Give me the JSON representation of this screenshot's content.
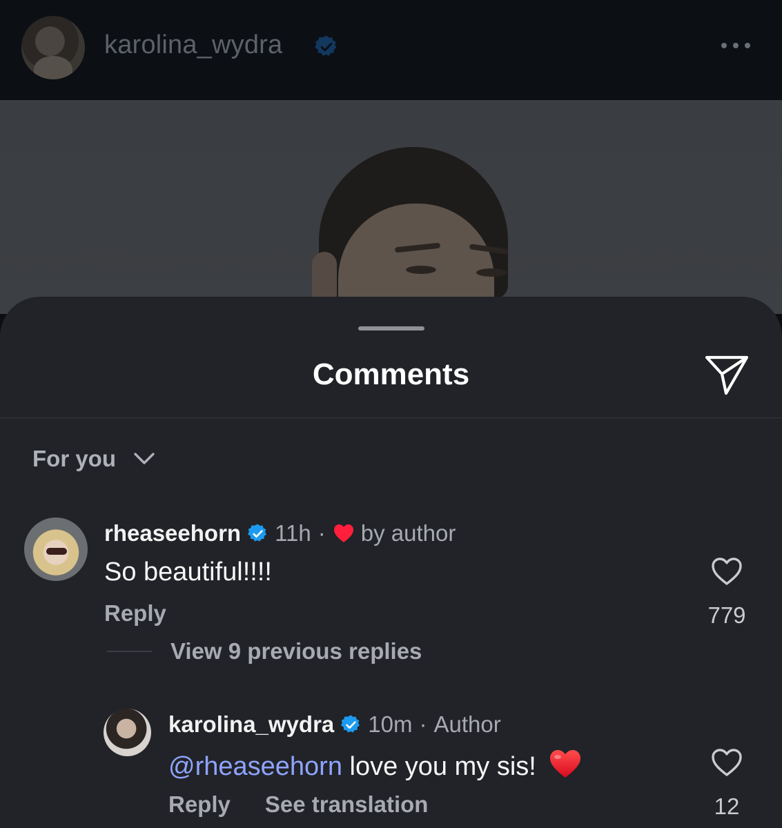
{
  "post_header": {
    "username": "karolina_wydra",
    "verified_icon": "verified-badge-icon",
    "more_icon": "more-options-icon"
  },
  "sheet": {
    "title": "Comments",
    "share_icon": "send-icon",
    "filter_label": "For you",
    "filter_icon": "chevron-down-icon"
  },
  "comments": [
    {
      "username": "rheaseehorn",
      "time": "11h",
      "separator": "·",
      "liked_by": "by author",
      "text": "So beautiful!!!!",
      "reply_label": "Reply",
      "likes": "779",
      "view_replies": "View 9 previous replies"
    },
    {
      "username": "karolina_wydra",
      "time": "10m",
      "separator": "·",
      "role": "Author",
      "mention": "@rheaseehorn",
      "text": " love you my sis!",
      "reply_label": "Reply",
      "translate_label": "See translation",
      "likes": "12"
    }
  ],
  "colors": {
    "verified": "#1d9bf0",
    "heart_red": "#ff1f3d",
    "mention": "#8fa4ff",
    "sheet_bg": "#212328"
  }
}
